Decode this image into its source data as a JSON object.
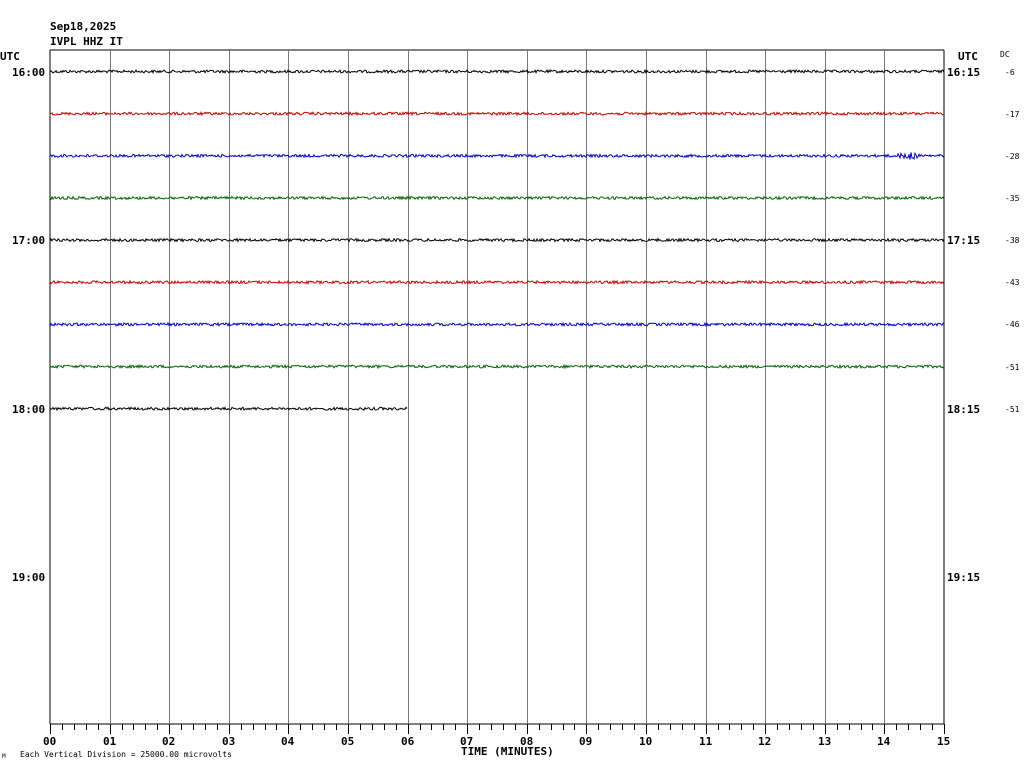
{
  "header": {
    "date": "Sep18,2025",
    "station": "IVPL HHZ IT",
    "utc_left": "UTC",
    "utc_right": "UTC",
    "dc_label": "DC"
  },
  "footer": {
    "xlabel": "TIME (MINUTES)",
    "scale_note": "Each Vertical Division = 25000.00 microvolts",
    "corner_mark": "M"
  },
  "chart_data": {
    "type": "line",
    "title": "IVPL HHZ IT",
    "xlabel": "TIME (MINUTES)",
    "xlim": [
      0,
      15
    ],
    "x_ticks": [
      "00",
      "01",
      "02",
      "03",
      "04",
      "05",
      "06",
      "07",
      "08",
      "09",
      "10",
      "11",
      "12",
      "13",
      "14",
      "15"
    ],
    "row_count": 16,
    "left_hour_labels": [
      {
        "row": 0,
        "label": "16:00"
      },
      {
        "row": 4,
        "label": "17:00"
      },
      {
        "row": 8,
        "label": "18:00"
      },
      {
        "row": 12,
        "label": "19:00"
      }
    ],
    "right_hour_labels": [
      {
        "row": 0,
        "label": "16:15"
      },
      {
        "row": 4,
        "label": "17:15"
      },
      {
        "row": 8,
        "label": "18:15"
      },
      {
        "row": 12,
        "label": "19:15"
      }
    ],
    "series": [
      {
        "row": 0,
        "color": "#000000",
        "x_end": 15,
        "dc": "-6"
      },
      {
        "row": 1,
        "color": "#cc0000",
        "x_end": 15,
        "dc": "-17"
      },
      {
        "row": 2,
        "color": "#0000cc",
        "x_end": 15,
        "dc": "-28",
        "event_at_min": 14.4
      },
      {
        "row": 3,
        "color": "#006600",
        "x_end": 15,
        "dc": "-35"
      },
      {
        "row": 4,
        "color": "#000000",
        "x_end": 15,
        "dc": "-38"
      },
      {
        "row": 5,
        "color": "#cc0000",
        "x_end": 15,
        "dc": "-43"
      },
      {
        "row": 6,
        "color": "#0000cc",
        "x_end": 15,
        "dc": "-46"
      },
      {
        "row": 7,
        "color": "#006600",
        "x_end": 15,
        "dc": "-51"
      },
      {
        "row": 8,
        "color": "#000000",
        "x_end": 6,
        "dc": "-51"
      }
    ],
    "vertical_division_microvolts": 25000.0
  }
}
